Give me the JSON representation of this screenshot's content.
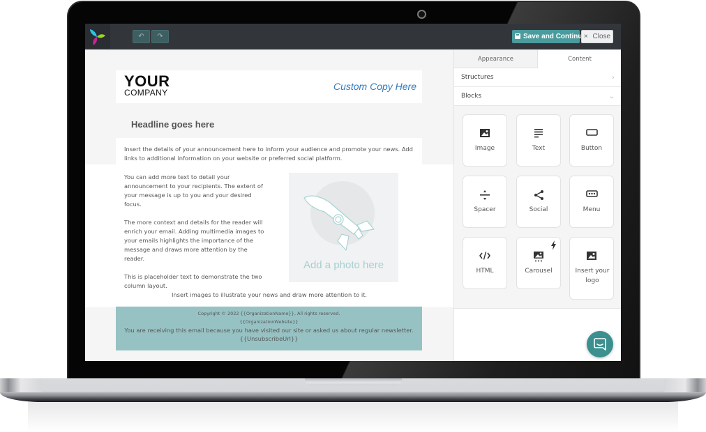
{
  "colors": {
    "accent": "#4a9b9d",
    "topbar": "#32363b",
    "footer_bg": "#97c2c4",
    "link_blue": "#2f7bbf",
    "chat_button": "#3b8f8f"
  },
  "toolbar": {
    "undo_icon": "undo-arrow",
    "redo_icon": "redo-arrow",
    "undo_glyph": "↶",
    "redo_glyph": "↷",
    "save_label": "Save and Continue",
    "close_glyph": "×",
    "close_label": "Close"
  },
  "email": {
    "logo_line1": "YOUR",
    "logo_line2": "COMPANY",
    "header_copy": "Custom Copy Here",
    "headline": "Headline goes here",
    "intro": "Insert the details of your announcement here to inform your audience and promote your news. Add links to additional information on your website or preferred social platform.",
    "column_paragraphs": [
      "You can add more text to detail your announcement to your recipients. The extent of your message is up to you and your desired focus.",
      "The more context and details for the reader will enrich your email. Adding multimedia images to your emails highlights the importance of the message and draws more attention by the reader.",
      "This is placeholder text to demonstrate the two column layout."
    ],
    "photo_placeholder": "Add a photo here",
    "caption": "Insert images to illustrate your news and draw more attention to it.",
    "footer": {
      "copyright": "Copyright © 2022 {{OrganizationName}}, All rights reserved.",
      "website": "{{OrganizationWebsite}}",
      "reason": "You are receiving this email because you have visited our site or asked us about regular newsletter.",
      "unsubscribe": "{{UnsubscribeUrl}}"
    }
  },
  "panel": {
    "tabs": [
      {
        "label": "Appearance",
        "active": false
      },
      {
        "label": "Content",
        "active": true
      }
    ],
    "sections": [
      {
        "label": "Structures",
        "chevron": "›",
        "expanded": false
      },
      {
        "label": "Blocks",
        "chevron": "⌄",
        "expanded": true
      }
    ],
    "blocks": [
      {
        "label": "Image",
        "icon": "image-icon"
      },
      {
        "label": "Text",
        "icon": "text-lines-icon"
      },
      {
        "label": "Button",
        "icon": "button-icon"
      },
      {
        "label": "Spacer",
        "icon": "divide-icon"
      },
      {
        "label": "Social",
        "icon": "share-icon"
      },
      {
        "label": "Menu",
        "icon": "menu-dots-icon"
      },
      {
        "label": "HTML",
        "icon": "code-icon"
      },
      {
        "label": "Carousel",
        "icon": "carousel-icon",
        "badge": "lightning-bolt-icon"
      },
      {
        "label": "Insert your logo",
        "icon": "image-icon"
      }
    ]
  },
  "chat": {
    "icon": "chat-bubble-icon"
  }
}
